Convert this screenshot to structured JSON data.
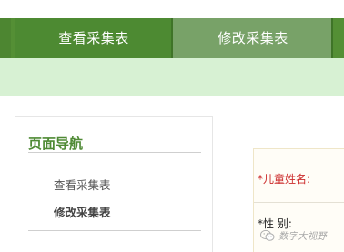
{
  "tabs": {
    "view_label": "查看采集表",
    "edit_label": "修改采集表"
  },
  "nav": {
    "title": "页面导航",
    "items": [
      "查看采集表",
      "修改采集表"
    ]
  },
  "form": {
    "child_name_label": "*儿童姓名:",
    "gender_label": "*性 别:"
  },
  "watermark": {
    "text": "数字大视野",
    "icon": "wechat-icon"
  },
  "colors": {
    "tab_bg": "#548f35",
    "tab_active_bg": "#78a268",
    "banner_bg": "#d7f1d3",
    "nav_title": "#4f8a35",
    "required_label": "#cc2b2b"
  }
}
